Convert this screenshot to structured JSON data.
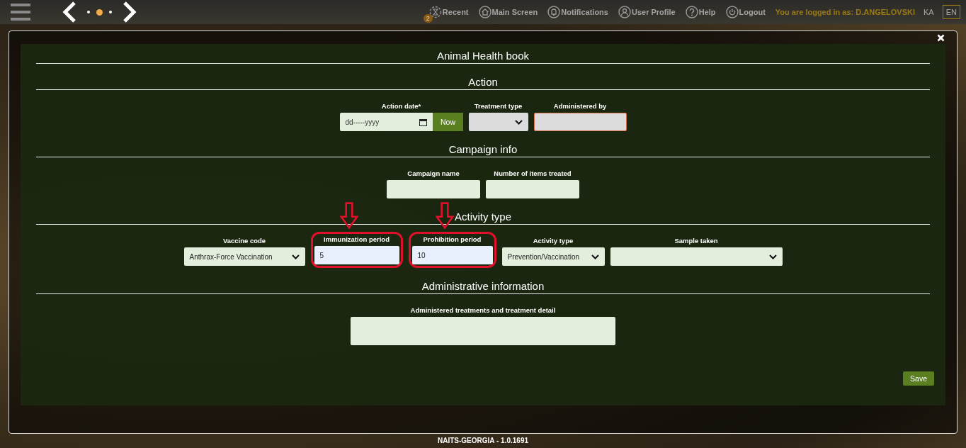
{
  "top_bar": {
    "nav_dots": [
      {
        "selected": false
      },
      {
        "selected": true
      },
      {
        "selected": false
      }
    ],
    "links": [
      {
        "kind": "recent",
        "label": "Recent",
        "badge": "2"
      },
      {
        "kind": "home",
        "label": "Main Screen"
      },
      {
        "kind": "bell",
        "label": "Notifications"
      },
      {
        "kind": "user",
        "label": "User Profile"
      },
      {
        "kind": "help",
        "label": "Help"
      },
      {
        "kind": "power",
        "label": "Logout"
      }
    ],
    "logged_in": "You are logged in as: D.ANGELOVSKI",
    "languages": [
      {
        "label": "KA",
        "selected": false
      },
      {
        "label": "EN",
        "selected": true
      }
    ]
  },
  "modal": {
    "title": "Animal Health book",
    "sections": [
      {
        "heading": "Action",
        "fields": [
          {
            "kind": "date",
            "label": "Action date*",
            "placeholder": "dd-----yyyy",
            "button": "Now",
            "highlighted": false
          },
          {
            "kind": "select",
            "label": "Treatment type",
            "highlighted": false
          },
          {
            "kind": "invalid",
            "label": "Administered by",
            "highlighted": false
          }
        ]
      },
      {
        "heading": "Campaign info",
        "fields": [
          {
            "kind": "input",
            "label": "Campaign name",
            "highlighted": false
          },
          {
            "kind": "input",
            "label": "Number of items treated",
            "highlighted": false
          }
        ]
      },
      {
        "heading": "Activity type",
        "fields": [
          {
            "kind": "select",
            "label": "Vaccine code",
            "value": "Anthrax-Force Vaccination",
            "highlighted": false
          },
          {
            "kind": "autofill",
            "label": "Immunization period",
            "value": "5",
            "highlighted": true
          },
          {
            "kind": "autofill",
            "label": "Prohibition period",
            "value": "10",
            "highlighted": true
          },
          {
            "kind": "select",
            "label": "Activity type",
            "value": "Prevention/Vaccination",
            "highlighted": false
          },
          {
            "kind": "select",
            "label": "Sample taken",
            "highlighted": false
          }
        ]
      },
      {
        "heading": "Administrative information",
        "fields": [
          {
            "kind": "textarea",
            "label": "Administered treatments and treatment detail",
            "highlighted": false
          }
        ]
      }
    ],
    "save": "Save"
  },
  "footer": "NAITS-GEORGIA - 1.0.1691"
}
